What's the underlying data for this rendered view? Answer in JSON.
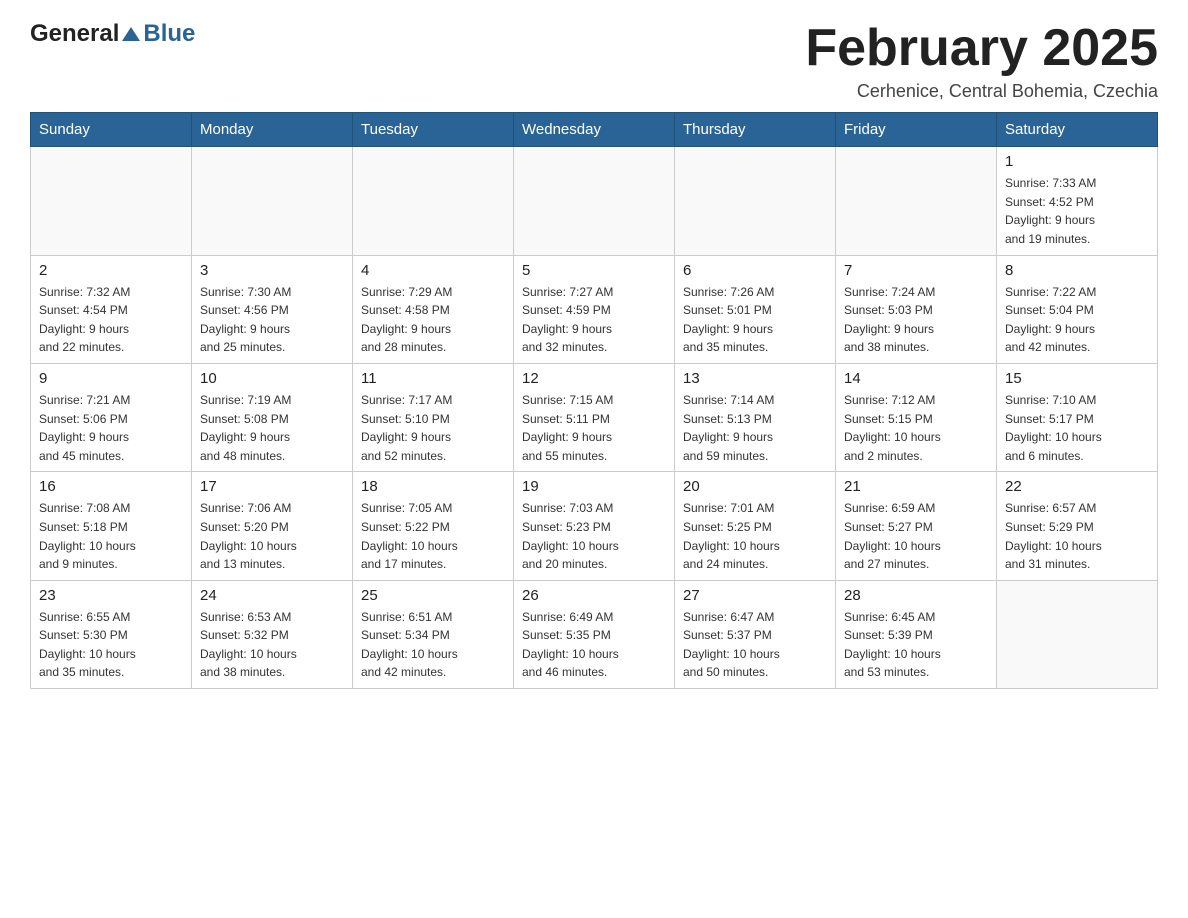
{
  "logo": {
    "text_general": "General",
    "text_blue": "Blue"
  },
  "header": {
    "month_title": "February 2025",
    "location": "Cerhenice, Central Bohemia, Czechia"
  },
  "weekdays": [
    "Sunday",
    "Monday",
    "Tuesday",
    "Wednesday",
    "Thursday",
    "Friday",
    "Saturday"
  ],
  "weeks": [
    [
      {
        "day": "",
        "info": ""
      },
      {
        "day": "",
        "info": ""
      },
      {
        "day": "",
        "info": ""
      },
      {
        "day": "",
        "info": ""
      },
      {
        "day": "",
        "info": ""
      },
      {
        "day": "",
        "info": ""
      },
      {
        "day": "1",
        "info": "Sunrise: 7:33 AM\nSunset: 4:52 PM\nDaylight: 9 hours\nand 19 minutes."
      }
    ],
    [
      {
        "day": "2",
        "info": "Sunrise: 7:32 AM\nSunset: 4:54 PM\nDaylight: 9 hours\nand 22 minutes."
      },
      {
        "day": "3",
        "info": "Sunrise: 7:30 AM\nSunset: 4:56 PM\nDaylight: 9 hours\nand 25 minutes."
      },
      {
        "day": "4",
        "info": "Sunrise: 7:29 AM\nSunset: 4:58 PM\nDaylight: 9 hours\nand 28 minutes."
      },
      {
        "day": "5",
        "info": "Sunrise: 7:27 AM\nSunset: 4:59 PM\nDaylight: 9 hours\nand 32 minutes."
      },
      {
        "day": "6",
        "info": "Sunrise: 7:26 AM\nSunset: 5:01 PM\nDaylight: 9 hours\nand 35 minutes."
      },
      {
        "day": "7",
        "info": "Sunrise: 7:24 AM\nSunset: 5:03 PM\nDaylight: 9 hours\nand 38 minutes."
      },
      {
        "day": "8",
        "info": "Sunrise: 7:22 AM\nSunset: 5:04 PM\nDaylight: 9 hours\nand 42 minutes."
      }
    ],
    [
      {
        "day": "9",
        "info": "Sunrise: 7:21 AM\nSunset: 5:06 PM\nDaylight: 9 hours\nand 45 minutes."
      },
      {
        "day": "10",
        "info": "Sunrise: 7:19 AM\nSunset: 5:08 PM\nDaylight: 9 hours\nand 48 minutes."
      },
      {
        "day": "11",
        "info": "Sunrise: 7:17 AM\nSunset: 5:10 PM\nDaylight: 9 hours\nand 52 minutes."
      },
      {
        "day": "12",
        "info": "Sunrise: 7:15 AM\nSunset: 5:11 PM\nDaylight: 9 hours\nand 55 minutes."
      },
      {
        "day": "13",
        "info": "Sunrise: 7:14 AM\nSunset: 5:13 PM\nDaylight: 9 hours\nand 59 minutes."
      },
      {
        "day": "14",
        "info": "Sunrise: 7:12 AM\nSunset: 5:15 PM\nDaylight: 10 hours\nand 2 minutes."
      },
      {
        "day": "15",
        "info": "Sunrise: 7:10 AM\nSunset: 5:17 PM\nDaylight: 10 hours\nand 6 minutes."
      }
    ],
    [
      {
        "day": "16",
        "info": "Sunrise: 7:08 AM\nSunset: 5:18 PM\nDaylight: 10 hours\nand 9 minutes."
      },
      {
        "day": "17",
        "info": "Sunrise: 7:06 AM\nSunset: 5:20 PM\nDaylight: 10 hours\nand 13 minutes."
      },
      {
        "day": "18",
        "info": "Sunrise: 7:05 AM\nSunset: 5:22 PM\nDaylight: 10 hours\nand 17 minutes."
      },
      {
        "day": "19",
        "info": "Sunrise: 7:03 AM\nSunset: 5:23 PM\nDaylight: 10 hours\nand 20 minutes."
      },
      {
        "day": "20",
        "info": "Sunrise: 7:01 AM\nSunset: 5:25 PM\nDaylight: 10 hours\nand 24 minutes."
      },
      {
        "day": "21",
        "info": "Sunrise: 6:59 AM\nSunset: 5:27 PM\nDaylight: 10 hours\nand 27 minutes."
      },
      {
        "day": "22",
        "info": "Sunrise: 6:57 AM\nSunset: 5:29 PM\nDaylight: 10 hours\nand 31 minutes."
      }
    ],
    [
      {
        "day": "23",
        "info": "Sunrise: 6:55 AM\nSunset: 5:30 PM\nDaylight: 10 hours\nand 35 minutes."
      },
      {
        "day": "24",
        "info": "Sunrise: 6:53 AM\nSunset: 5:32 PM\nDaylight: 10 hours\nand 38 minutes."
      },
      {
        "day": "25",
        "info": "Sunrise: 6:51 AM\nSunset: 5:34 PM\nDaylight: 10 hours\nand 42 minutes."
      },
      {
        "day": "26",
        "info": "Sunrise: 6:49 AM\nSunset: 5:35 PM\nDaylight: 10 hours\nand 46 minutes."
      },
      {
        "day": "27",
        "info": "Sunrise: 6:47 AM\nSunset: 5:37 PM\nDaylight: 10 hours\nand 50 minutes."
      },
      {
        "day": "28",
        "info": "Sunrise: 6:45 AM\nSunset: 5:39 PM\nDaylight: 10 hours\nand 53 minutes."
      },
      {
        "day": "",
        "info": ""
      }
    ]
  ]
}
